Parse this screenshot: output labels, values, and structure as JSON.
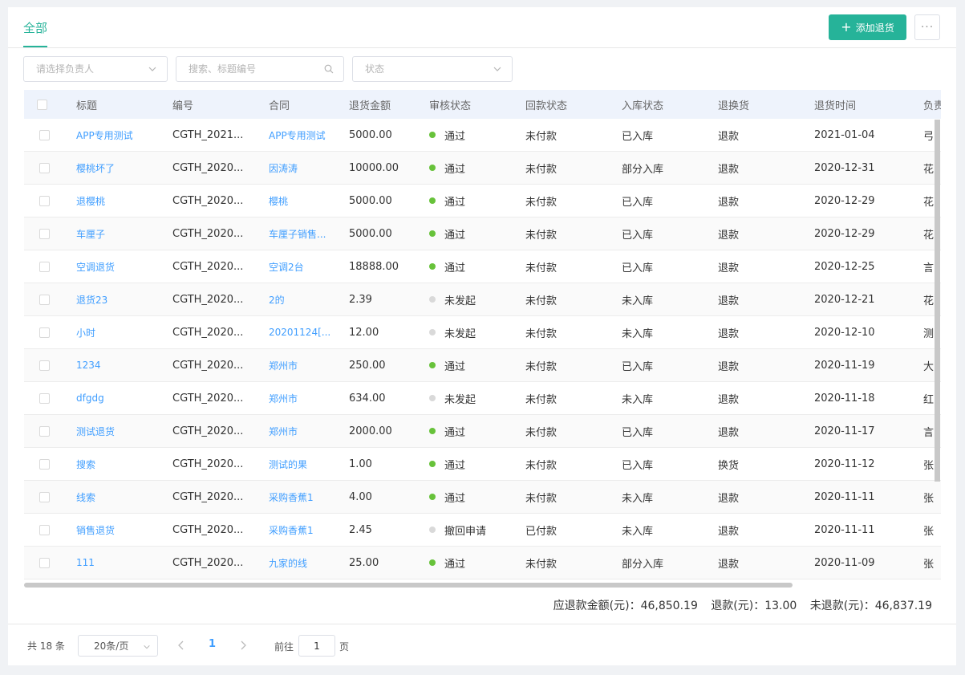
{
  "tabs": {
    "active": "全部"
  },
  "toolbar": {
    "add_label": "添加退货",
    "more_label": "···"
  },
  "filters": {
    "owner_placeholder": "请选择负责人",
    "search_placeholder": "搜索、标题编号",
    "status_placeholder": "状态"
  },
  "table": {
    "headers": [
      "标题",
      "编号",
      "合同",
      "退货金额",
      "审核状态",
      "回款状态",
      "入库状态",
      "退换货",
      "退货时间",
      "负责"
    ],
    "rows": [
      {
        "title": "APP专用测试",
        "code": "CGTH_2021...",
        "contract": "APP专用测试",
        "amount": "5000.00",
        "audit": "通过",
        "audit_color": "#67c23a",
        "payment": "未付款",
        "stock": "已入库",
        "type": "退款",
        "date": "2021-01-04",
        "owner": "弓"
      },
      {
        "title": "樱桃坏了",
        "code": "CGTH_2020...",
        "contract": "因涛涛",
        "amount": "10000.00",
        "audit": "通过",
        "audit_color": "#67c23a",
        "payment": "未付款",
        "stock": "部分入库",
        "type": "退款",
        "date": "2020-12-31",
        "owner": "花"
      },
      {
        "title": "退樱桃",
        "code": "CGTH_2020...",
        "contract": "樱桃",
        "amount": "5000.00",
        "audit": "通过",
        "audit_color": "#67c23a",
        "payment": "未付款",
        "stock": "已入库",
        "type": "退款",
        "date": "2020-12-29",
        "owner": "花"
      },
      {
        "title": "车厘子",
        "code": "CGTH_2020...",
        "contract": "车厘子销售...",
        "amount": "5000.00",
        "audit": "通过",
        "audit_color": "#67c23a",
        "payment": "未付款",
        "stock": "已入库",
        "type": "退款",
        "date": "2020-12-29",
        "owner": "花"
      },
      {
        "title": "空调退货",
        "code": "CGTH_2020...",
        "contract": "空调2台",
        "amount": "18888.00",
        "audit": "通过",
        "audit_color": "#67c23a",
        "payment": "未付款",
        "stock": "已入库",
        "type": "退款",
        "date": "2020-12-25",
        "owner": "言"
      },
      {
        "title": "退货23",
        "code": "CGTH_2020...",
        "contract": "2的",
        "amount": "2.39",
        "audit": "未发起",
        "audit_color": "#d9d9d9",
        "payment": "未付款",
        "stock": "未入库",
        "type": "退款",
        "date": "2020-12-21",
        "owner": "花"
      },
      {
        "title": "小时",
        "code": "CGTH_2020...",
        "contract": "20201124[...",
        "amount": "12.00",
        "audit": "未发起",
        "audit_color": "#d9d9d9",
        "payment": "未付款",
        "stock": "未入库",
        "type": "退款",
        "date": "2020-12-10",
        "owner": "测"
      },
      {
        "title": "1234",
        "code": "CGTH_2020...",
        "contract": "郑州市",
        "amount": "250.00",
        "audit": "通过",
        "audit_color": "#67c23a",
        "payment": "未付款",
        "stock": "已入库",
        "type": "退款",
        "date": "2020-11-19",
        "owner": "大"
      },
      {
        "title": "dfgdg",
        "code": "CGTH_2020...",
        "contract": "郑州市",
        "amount": "634.00",
        "audit": "未发起",
        "audit_color": "#d9d9d9",
        "payment": "未付款",
        "stock": "未入库",
        "type": "退款",
        "date": "2020-11-18",
        "owner": "红"
      },
      {
        "title": "测试退货",
        "code": "CGTH_2020...",
        "contract": "郑州市",
        "amount": "2000.00",
        "audit": "通过",
        "audit_color": "#67c23a",
        "payment": "未付款",
        "stock": "已入库",
        "type": "退款",
        "date": "2020-11-17",
        "owner": "言"
      },
      {
        "title": "搜索",
        "code": "CGTH_2020...",
        "contract": "测试的果",
        "amount": "1.00",
        "audit": "通过",
        "audit_color": "#67c23a",
        "payment": "未付款",
        "stock": "已入库",
        "type": "换货",
        "date": "2020-11-12",
        "owner": "张"
      },
      {
        "title": "线索",
        "code": "CGTH_2020...",
        "contract": "采购香蕉1",
        "amount": "4.00",
        "audit": "通过",
        "audit_color": "#67c23a",
        "payment": "未付款",
        "stock": "未入库",
        "type": "退款",
        "date": "2020-11-11",
        "owner": "张"
      },
      {
        "title": "销售退货",
        "code": "CGTH_2020...",
        "contract": "采购香蕉1",
        "amount": "2.45",
        "audit": "撤回申请",
        "audit_color": "#d9d9d9",
        "payment": "已付款",
        "stock": "未入库",
        "type": "退款",
        "date": "2020-11-11",
        "owner": "张"
      },
      {
        "title": "111",
        "code": "CGTH_2020...",
        "contract": "九家的线",
        "amount": "25.00",
        "audit": "通过",
        "audit_color": "#67c23a",
        "payment": "未付款",
        "stock": "部分入库",
        "type": "退款",
        "date": "2020-11-09",
        "owner": "张"
      }
    ]
  },
  "summary": {
    "due_label": "应退款金额(元)：",
    "due_value": "46,850.19",
    "refunded_label": "退款(元)：",
    "refunded_value": "13.00",
    "pending_label": "未退款(元)：",
    "pending_value": "46,837.19"
  },
  "pagination": {
    "total": "共 18 条",
    "page_size": "20条/页",
    "current_page": "1",
    "goto_label": "前往",
    "goto_value": "1",
    "goto_unit": "页"
  }
}
